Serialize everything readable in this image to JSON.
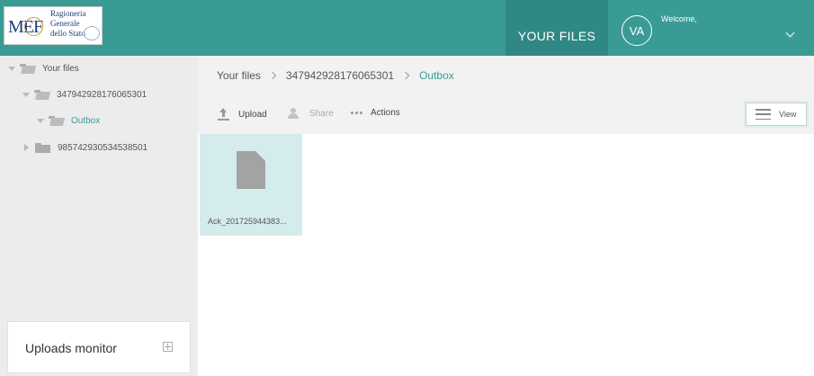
{
  "header": {
    "logo": {
      "mark": "MEF",
      "lines": [
        "Ragioneria",
        "Generale",
        "dello Stato"
      ]
    },
    "nav_your_files": "YOUR FILES",
    "user": {
      "initials": "VA",
      "welcome": "Welcome,"
    },
    "colors": {
      "header_bg": "#3a9b95",
      "active_nav_bg": "#2f8883"
    }
  },
  "sidebar": {
    "tree": [
      {
        "label": "Your files",
        "expanded": true
      },
      {
        "label": "347942928176065301",
        "expanded": true
      },
      {
        "label": "Outbox",
        "expanded": true,
        "active": true
      },
      {
        "label": "985742930534538501",
        "expanded": false
      }
    ],
    "uploads_monitor": "Uploads monitor"
  },
  "main": {
    "breadcrumb": [
      "Your files",
      "347942928176065301",
      "Outbox"
    ],
    "toolbar": {
      "upload": "Upload",
      "share": "Share",
      "actions": "Actions",
      "view": "View"
    },
    "files": [
      {
        "name": "Ack_201725944383...",
        "icon": "document-icon",
        "selected": true
      }
    ]
  }
}
